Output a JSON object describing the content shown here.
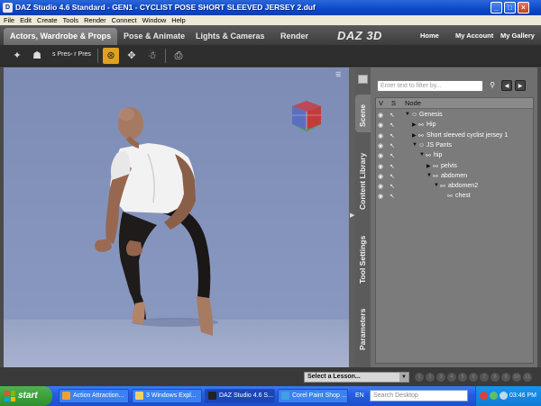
{
  "window": {
    "title": "DAZ Studio 4.6 Standard - GEN1 - CYCLIST POSE SHORT SLEEVED JERSEY 2.duf",
    "controls": [
      "_",
      "□",
      "×"
    ]
  },
  "menu": [
    "File",
    "Edit",
    "Create",
    "Tools",
    "Render",
    "Connect",
    "Window",
    "Help"
  ],
  "tabs": [
    "Actors, Wardrobe & Props",
    "Pose & Animate",
    "Lights & Cameras",
    "Render"
  ],
  "brand": {
    "logo": "DAZ 3D",
    "links": [
      "Home",
      "My Account",
      "My Gallery"
    ]
  },
  "toolbar": {
    "text": "s Pres◦ r Pres"
  },
  "scene_panel": {
    "vertical_tabs": [
      "Scene",
      "Content Library",
      "Tool Settings",
      "Parameters"
    ],
    "filter_placeholder": "Enter text to filter by...",
    "columns": [
      "V",
      "S",
      "Node"
    ],
    "nodes": [
      {
        "label": "Genesis",
        "indent": 0,
        "expand": "▼",
        "icon": "figure-icon"
      },
      {
        "label": "Hip",
        "indent": 1,
        "expand": "▶",
        "icon": "bone-icon"
      },
      {
        "label": "Short sleeved cyclist jersey 1",
        "indent": 1,
        "expand": "▶",
        "icon": "clothing-icon"
      },
      {
        "label": "JS Pants",
        "indent": 1,
        "expand": "▼",
        "icon": "figure-icon"
      },
      {
        "label": "hip",
        "indent": 2,
        "expand": "▼",
        "icon": "bone-icon"
      },
      {
        "label": "pelvis",
        "indent": 3,
        "expand": "▶",
        "icon": "bone-icon"
      },
      {
        "label": "abdomen",
        "indent": 3,
        "expand": "▼",
        "icon": "bone-icon"
      },
      {
        "label": "abdomen2",
        "indent": 4,
        "expand": "▼",
        "icon": "bone-icon"
      },
      {
        "label": "chest",
        "indent": 5,
        "expand": "",
        "icon": "bone-icon"
      }
    ]
  },
  "lesson": {
    "select_label": "Select a Lesson...",
    "pages": [
      "1",
      "2",
      "3",
      "4",
      "5",
      "6",
      "7",
      "8",
      "9",
      "10",
      "11"
    ]
  },
  "taskbar": {
    "start_label": "start",
    "buttons": [
      "Action Attraction...",
      "3 Windows Expl...",
      "DAZ Studio 4.6 S...",
      "Corel Paint Shop ..."
    ],
    "language": "EN",
    "search_placeholder": "Search Desktop",
    "clock": "03:46 PM"
  }
}
